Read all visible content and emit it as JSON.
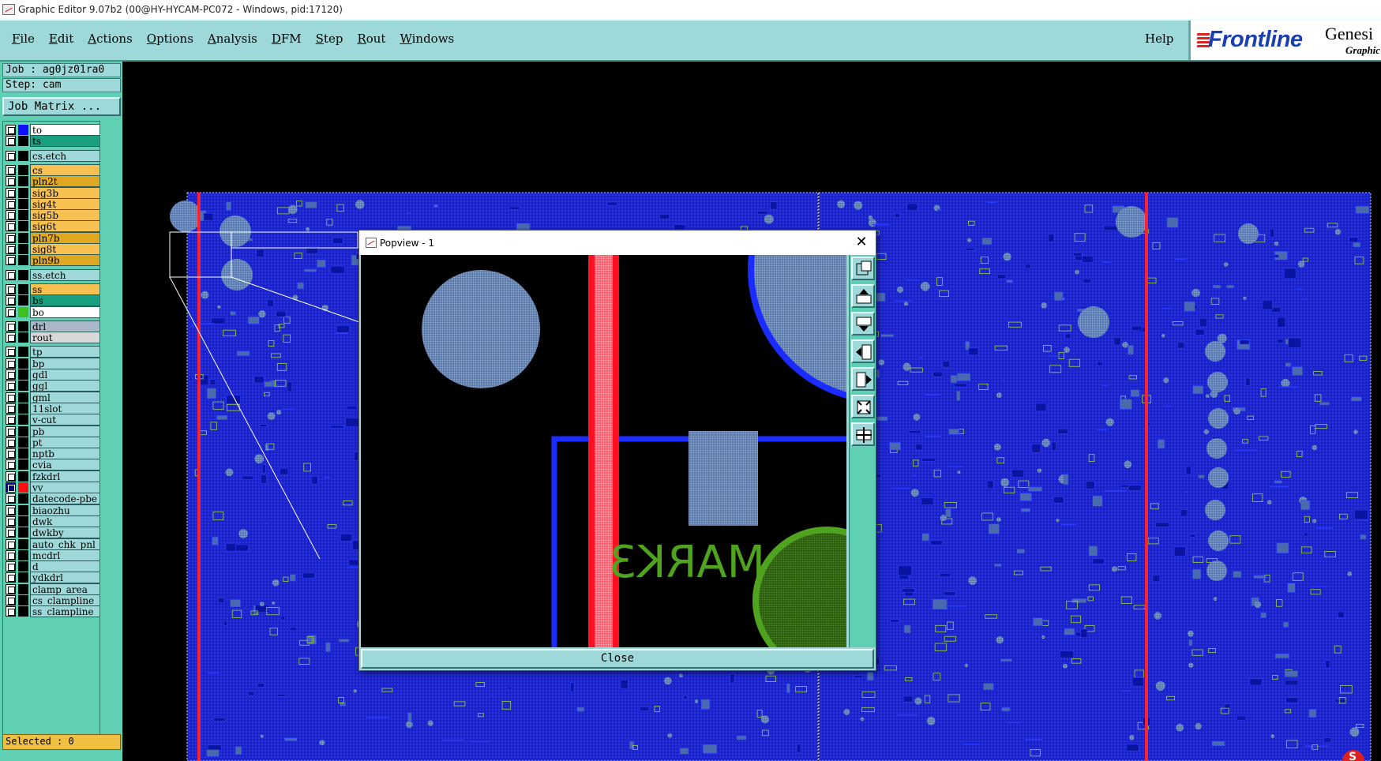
{
  "window": {
    "title": "Graphic Editor 9.07b2 (00@HY-HYCAM-PC072 - Windows, pid:17120)"
  },
  "menu": {
    "items": [
      {
        "label": "File",
        "ul": "F",
        "rest": "ile"
      },
      {
        "label": "Edit",
        "ul": "E",
        "rest": "dit"
      },
      {
        "label": "Actions",
        "ul": "A",
        "rest": "ctions"
      },
      {
        "label": "Options",
        "ul": "O",
        "rest": "ptions"
      },
      {
        "label": "Analysis",
        "ul": "A",
        "rest": "nalysis"
      },
      {
        "label": "DFM",
        "ul": "D",
        "rest": "FM"
      },
      {
        "label": "Step",
        "ul": "S",
        "rest": "tep"
      },
      {
        "label": "Rout",
        "ul": "R",
        "rest": "out"
      },
      {
        "label": "Windows",
        "ul": "W",
        "rest": "indows"
      }
    ],
    "help": "Help"
  },
  "logo": {
    "brand": "Frontline",
    "product": "Genesi",
    "subtitle": "Graphic"
  },
  "job": {
    "job_line": "Job : ag0jz01ra0",
    "step_line": "Step: cam",
    "matrix_button": "Job Matrix ..."
  },
  "layers": [
    {
      "name": "to",
      "swatch": "#1010ff",
      "bg": "#ffffff",
      "checked": false
    },
    {
      "name": "ts",
      "swatch": "#000000",
      "bg": "#1aa080",
      "checked": false
    },
    {
      "name": "cs.etch",
      "swatch": "#000000",
      "bg": "#9fd8d8",
      "checked": false
    },
    {
      "name": "cs",
      "swatch": "#000000",
      "bg": "#f8c050",
      "checked": false
    },
    {
      "name": "pln2t",
      "swatch": "#000000",
      "bg": "#e0a820",
      "checked": false
    },
    {
      "name": "sig3b",
      "swatch": "#000000",
      "bg": "#f8c050",
      "checked": false
    },
    {
      "name": "sig4t",
      "swatch": "#000000",
      "bg": "#f8c050",
      "checked": false
    },
    {
      "name": "sig5b",
      "swatch": "#000000",
      "bg": "#f8c050",
      "checked": false
    },
    {
      "name": "sig6t",
      "swatch": "#000000",
      "bg": "#f8c050",
      "checked": false
    },
    {
      "name": "pln7b",
      "swatch": "#000000",
      "bg": "#e0a820",
      "checked": false
    },
    {
      "name": "sig8t",
      "swatch": "#000000",
      "bg": "#f8c050",
      "checked": false
    },
    {
      "name": "pln9b",
      "swatch": "#000000",
      "bg": "#e0a820",
      "checked": false
    },
    {
      "name": "ss.etch",
      "swatch": "#000000",
      "bg": "#9fd8d8",
      "checked": false
    },
    {
      "name": "ss",
      "swatch": "#000000",
      "bg": "#f8c050",
      "checked": false
    },
    {
      "name": "bs",
      "swatch": "#000000",
      "bg": "#1aa080",
      "checked": false
    },
    {
      "name": "bo",
      "swatch": "#40c020",
      "bg": "#ffffff",
      "checked": false
    },
    {
      "name": "drl",
      "swatch": "#000000",
      "bg": "#a8b8c8",
      "checked": false
    },
    {
      "name": "rout",
      "swatch": "#000000",
      "bg": "#d8d8d8",
      "checked": false
    },
    {
      "name": "tp",
      "swatch": "#000000",
      "bg": "#9fd8d8",
      "checked": false
    },
    {
      "name": "bp",
      "swatch": "#000000",
      "bg": "#9fd8d8",
      "checked": false
    },
    {
      "name": "gdl",
      "swatch": "#000000",
      "bg": "#9fd8d8",
      "checked": false
    },
    {
      "name": "ggl",
      "swatch": "#000000",
      "bg": "#9fd8d8",
      "checked": false
    },
    {
      "name": "gml",
      "swatch": "#000000",
      "bg": "#9fd8d8",
      "checked": false
    },
    {
      "name": "11slot",
      "swatch": "#000000",
      "bg": "#9fd8d8",
      "checked": false
    },
    {
      "name": "v-cut",
      "swatch": "#000000",
      "bg": "#9fd8d8",
      "checked": false
    },
    {
      "name": "pb",
      "swatch": "#000000",
      "bg": "#9fd8d8",
      "checked": false
    },
    {
      "name": "pt",
      "swatch": "#000000",
      "bg": "#9fd8d8",
      "checked": false
    },
    {
      "name": "nptb",
      "swatch": "#000000",
      "bg": "#9fd8d8",
      "checked": false
    },
    {
      "name": "cvia",
      "swatch": "#000000",
      "bg": "#9fd8d8",
      "checked": false
    },
    {
      "name": "fzkdrl",
      "swatch": "#000000",
      "bg": "#9fd8d8",
      "checked": false
    },
    {
      "name": "vv",
      "swatch": "#ff1010",
      "bg": "#9fd8d8",
      "checked": true
    },
    {
      "name": "datecode-pbe",
      "swatch": "#000000",
      "bg": "#9fd8d8",
      "checked": false
    },
    {
      "name": "biaozhu",
      "swatch": "#000000",
      "bg": "#9fd8d8",
      "checked": false
    },
    {
      "name": "dwk",
      "swatch": "#000000",
      "bg": "#9fd8d8",
      "checked": false
    },
    {
      "name": "dwkby",
      "swatch": "#000000",
      "bg": "#9fd8d8",
      "checked": false
    },
    {
      "name": "auto_chk_pnl",
      "swatch": "#000000",
      "bg": "#9fd8d8",
      "checked": false
    },
    {
      "name": "mcdrl",
      "swatch": "#000000",
      "bg": "#9fd8d8",
      "checked": false
    },
    {
      "name": "d",
      "swatch": "#000000",
      "bg": "#9fd8d8",
      "checked": false
    },
    {
      "name": "ydkdrl",
      "swatch": "#000000",
      "bg": "#9fd8d8",
      "checked": false
    },
    {
      "name": "clamp_area",
      "swatch": "#000000",
      "bg": "#9fd8d8",
      "checked": false
    },
    {
      "name": "cs_clampline",
      "swatch": "#000000",
      "bg": "#9fd8d8",
      "checked": false
    },
    {
      "name": "ss_clampline",
      "swatch": "#000000",
      "bg": "#9fd8d8",
      "checked": false
    }
  ],
  "status": {
    "selected": "Selected : 0"
  },
  "popview": {
    "title": "Popview - 1",
    "close_x": "✕",
    "close_button": "Close",
    "mark_text": "MARK3",
    "tools": [
      "zoom-window-icon",
      "pan-up-icon",
      "pan-down-icon",
      "pan-left-icon",
      "pan-right-icon",
      "zoom-fit-icon",
      "zoom-home-icon"
    ]
  },
  "colors": {
    "panel": "#9fd8d8",
    "panel_dark": "#5fd0b4",
    "trace_blue": "#1a2cff",
    "pad_grey": "#6f8fb8",
    "silk_green": "#4fa31f",
    "rout_red": "#ff2030"
  }
}
